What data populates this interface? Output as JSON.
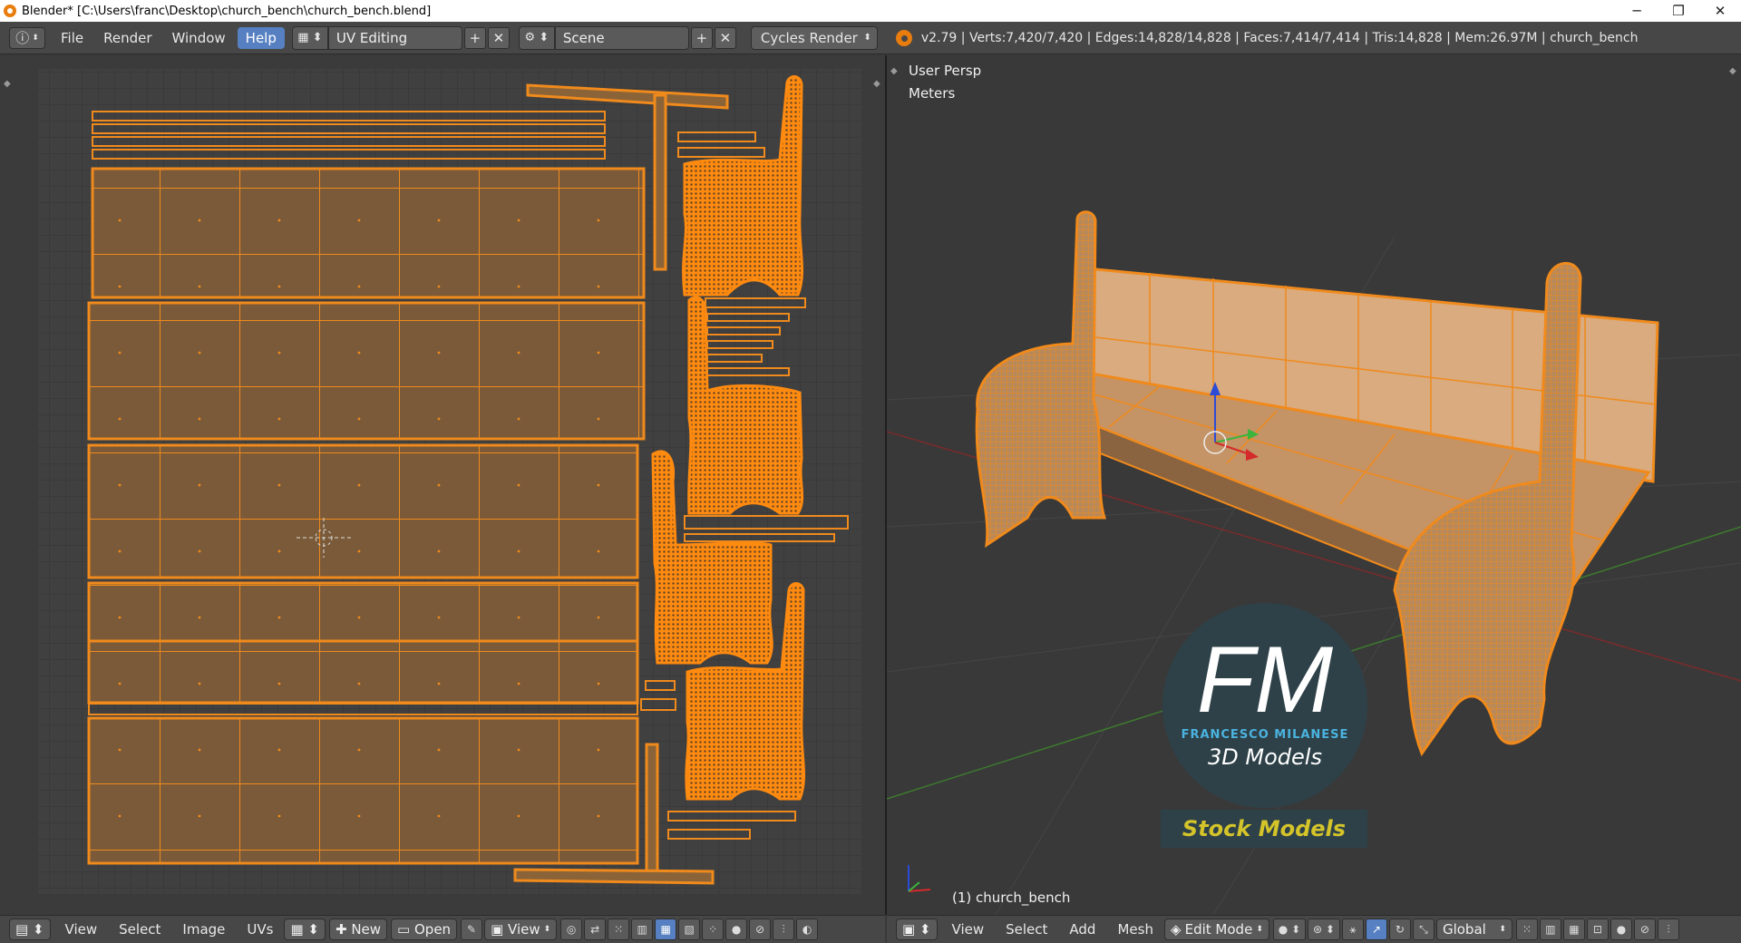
{
  "window": {
    "title": "Blender* [C:\\Users\\franc\\Desktop\\church_bench\\church_bench.blend]",
    "minimize": "─",
    "maximize": "❐",
    "close": "✕"
  },
  "topbar": {
    "info_icon": "info-icon",
    "menus": [
      "File",
      "Render",
      "Window",
      "Help"
    ],
    "active_menu": "Help",
    "screen_layout": "UV Editing",
    "scene": "Scene",
    "render_engine": "Cycles Render",
    "stats": "v2.79 | Verts:7,420/7,420 | Edges:14,828/14,828 | Faces:7,414/7,414 | Tris:14,828 | Mem:26.97M | church_bench",
    "add": "+",
    "remove": "✕"
  },
  "viewport": {
    "view_name": "User Persp",
    "units": "Meters",
    "object_label": "(1) church_bench",
    "watermark": {
      "logo": "FM",
      "name": "FRANCESCO MILANESE",
      "tagline": "3D Models",
      "badge": "Stock Models"
    }
  },
  "uv_header": {
    "menus": [
      "View",
      "Select",
      "Image",
      "UVs"
    ],
    "new_label": "New",
    "open_label": "Open",
    "view_label": "View"
  },
  "view3d_header": {
    "menus": [
      "View",
      "Select",
      "Add",
      "Mesh"
    ],
    "mode": "Edit Mode",
    "orientation": "Global"
  },
  "colors": {
    "wire": "#f08a1c",
    "face": "#7a5a38",
    "grid_bg": "#404040",
    "accent": "#5680c2"
  }
}
